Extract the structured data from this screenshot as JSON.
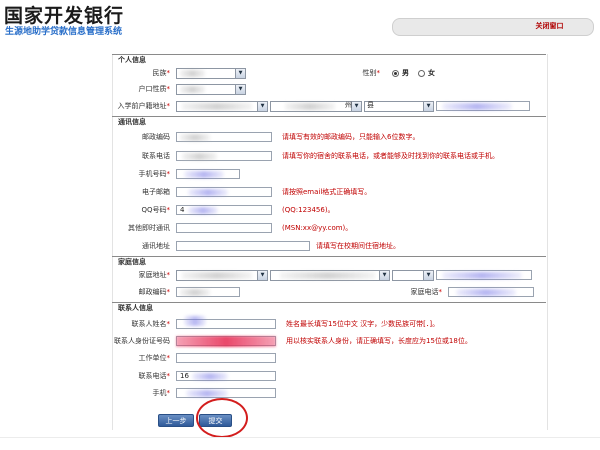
{
  "header": {
    "bank_name": "国家开发银行",
    "system_name": "生源地助学贷款信息管理系统",
    "close_label": "关闭窗口"
  },
  "sections": {
    "personal": "个人信息",
    "contact": "通讯信息",
    "family": "家庭信息",
    "contact_person": "联系人信息"
  },
  "personal": {
    "ethnicity_label": "民族",
    "gender_label": "性别",
    "gender_male": "男",
    "gender_female": "女",
    "hukou_label": "户口性质",
    "address_label": "入学前户籍地址",
    "address_city_suffix": "州",
    "address_county_prefix": "县"
  },
  "contact": {
    "postcode_label": "邮政编码",
    "postcode_hint": "请填写有效的邮政编码，只能输入6位数字。",
    "phone_label": "联系电话",
    "phone_hint": "请填写你的宿舍的联系电话，或者能够及时找到你的联系电话或手机。",
    "mobile_label": "手机号码",
    "email_label": "电子邮箱",
    "email_hint": "请按照email格式正确填写。",
    "qq_label": "QQ号码",
    "qq_value_prefix": "4",
    "qq_hint": "(QQ:123456)。",
    "im_label": "其他即时通讯",
    "im_hint": "(MSN:xx@yy.com)。",
    "address_label": "通讯地址",
    "address_hint": "请填写在校期间住宿地址。"
  },
  "family": {
    "address_label": "家庭地址",
    "postcode_label": "邮政编码",
    "phone_label": "家庭电话"
  },
  "contact_person": {
    "name_label": "联系人姓名",
    "name_hint": "姓名最长填写15位中文 汉字，少数民族可带[．]。",
    "id_label": "联系人身份证号码",
    "id_hint": "用以核实联系人身份，请正确填写，长度应为15位或18位。",
    "work_label": "工作单位",
    "phone_label": "联系电话",
    "phone_value_prefix": "16",
    "mobile_label": "手机"
  },
  "buttons": {
    "prev_label": "上一步",
    "submit_label": "提交"
  },
  "colors": {
    "accent_blue": "#2a6fc9",
    "hint_red": "#c00000",
    "annotation_circle": "#d31d1d",
    "button_blue": "#2f5a99"
  }
}
